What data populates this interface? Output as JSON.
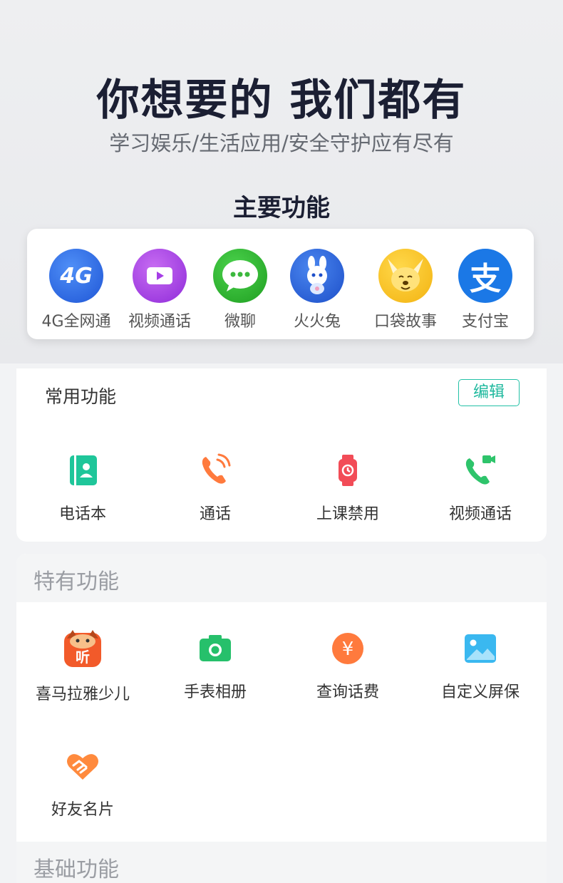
{
  "hero": {
    "headline": "你想要的 我们都有",
    "subline": "学习娱乐/生活应用/安全守护应有尽有",
    "main_title": "主要功能"
  },
  "main_features": [
    {
      "label": "4G全网通",
      "icon": "4g-network-icon",
      "color": "#2f6fe6",
      "glyph": "4G"
    },
    {
      "label": "视频通话",
      "icon": "video-call-icon",
      "color": "#a63ee6"
    },
    {
      "label": "微聊",
      "icon": "chat-bubble-icon",
      "color": "#2cb82f"
    },
    {
      "label": "火火兔",
      "icon": "rabbit-icon",
      "color": "#2f6fe6"
    },
    {
      "label": "口袋故事",
      "icon": "fox-icon",
      "color": "#f7c21b"
    },
    {
      "label": "支付宝",
      "icon": "alipay-icon",
      "color": "#1b78e6",
      "glyph": "支"
    }
  ],
  "common": {
    "title": "常用功能",
    "edit_label": "编辑",
    "items": [
      {
        "label": "电话本",
        "icon": "contacts-book-icon",
        "color": "#1fc69a"
      },
      {
        "label": "通话",
        "icon": "phone-call-icon",
        "color": "#ff7a3d"
      },
      {
        "label": "上课禁用",
        "icon": "watch-lock-icon",
        "color": "#f24c57"
      },
      {
        "label": "视频通话",
        "icon": "video-phone-icon",
        "color": "#2ec46b"
      }
    ]
  },
  "special": {
    "title": "特有功能",
    "items": [
      {
        "label": "喜马拉雅少儿",
        "icon": "ximalaya-kids-icon",
        "color": "#f25a2a",
        "glyph": "听"
      },
      {
        "label": "手表相册",
        "icon": "camera-icon",
        "color": "#26c06b"
      },
      {
        "label": "查询话费",
        "icon": "yuan-coin-icon",
        "color": "#ff7a3d",
        "glyph": "¥"
      },
      {
        "label": "自定义屏保",
        "icon": "picture-icon",
        "color": "#3ab8f0"
      },
      {
        "label": "好友名片",
        "icon": "handshake-heart-icon",
        "color": "#ff8a3d"
      }
    ]
  },
  "basic": {
    "title": "基础功能"
  }
}
